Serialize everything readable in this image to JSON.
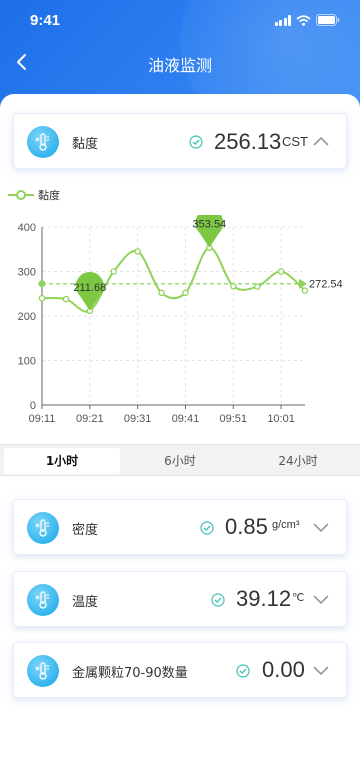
{
  "status_bar": {
    "time": "9:41"
  },
  "nav": {
    "title": "油液监测"
  },
  "primary_metric": {
    "label": "黏度",
    "value": "256.13",
    "unit": "CST"
  },
  "legend": {
    "label": "黏度"
  },
  "chart_data": {
    "type": "line",
    "x": [
      "09:11",
      "09:16",
      "09:21",
      "09:26",
      "09:31",
      "09:36",
      "09:41",
      "09:46",
      "09:51",
      "09:56",
      "10:01",
      "10:06"
    ],
    "xticks": [
      "09:11",
      "09:21",
      "09:31",
      "09:41",
      "09:51",
      "10:01"
    ],
    "series": [
      {
        "name": "黏度",
        "values": [
          240,
          238,
          211.68,
          300,
          345,
          252,
          252,
          353.54,
          267,
          266,
          300,
          257
        ]
      }
    ],
    "ylim": [
      0,
      400
    ],
    "yticks": [
      "0",
      "100",
      "200",
      "300",
      "400"
    ],
    "markers": {
      "min": "211.68",
      "max": "353.54"
    },
    "average": "272.54",
    "grid": true,
    "line_color": "#8fd35a"
  },
  "tabs": [
    {
      "label": "1小时"
    },
    {
      "label": "6小时"
    },
    {
      "label": "24小时"
    }
  ],
  "metrics": [
    {
      "label": "密度",
      "value": "0.85",
      "unit": "g/cm³"
    },
    {
      "label": "温度",
      "value": "39.12",
      "unit": "℃"
    },
    {
      "label": "金属颗粒70-90数量",
      "value": "0.00",
      "unit": ""
    }
  ]
}
